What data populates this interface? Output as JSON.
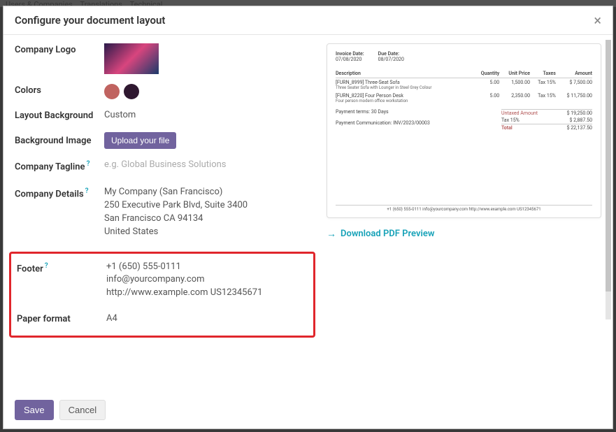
{
  "modal": {
    "title": "Configure your document layout",
    "close_icon": "×"
  },
  "form": {
    "logo_label": "Company Logo",
    "colors_label": "Colors",
    "layout_bg_label": "Layout Background",
    "layout_bg_value": "Custom",
    "bg_image_label": "Background Image",
    "upload_label": "Upload your file",
    "tagline_label": "Company Tagline",
    "tagline_placeholder": "e.g. Global Business Solutions",
    "details_label": "Company Details",
    "details_line1": "My Company (San Francisco)",
    "details_line2": "250 Executive Park Blvd, Suite 3400",
    "details_line3": "San Francisco CA 94134",
    "details_line4": "United States",
    "footer_label": "Footer",
    "footer_line1": "+1 (650) 555-0111",
    "footer_line2": "info@yourcompany.com",
    "footer_line3": "http://www.example.com US12345671",
    "paper_label": "Paper format",
    "paper_value": "A4"
  },
  "preview": {
    "invoice_date_label": "Invoice Date:",
    "invoice_date": "07/08/2020",
    "due_date_label": "Due Date:",
    "due_date": "08/07/2020",
    "th_desc": "Description",
    "th_qty": "Quantity",
    "th_unit": "Unit Price",
    "th_taxes": "Taxes",
    "th_amount": "Amount",
    "r1_name": "[FURN_8999] Three-Seat Sofa",
    "r1_desc": "Three Seater Sofa with Lounger in Steel Grey Colour",
    "r1_qty": "5.00",
    "r1_unit": "1,500.00",
    "r1_tax": "Tax 15%",
    "r1_amount": "$ 7,500.00",
    "r2_name": "[FURN_8220] Four Person Desk",
    "r2_desc": "Four person modern office workstation",
    "r2_qty": "5.00",
    "r2_unit": "2,350.00",
    "r2_tax": "Tax 15%",
    "r2_amount": "$ 11,750.00",
    "terms_label": "Payment terms:",
    "terms_val": "30 Days",
    "comm_label": "Payment Communication:",
    "comm_val": "INV/2023/00003",
    "untaxed_label": "Untaxed Amount",
    "untaxed_val": "$ 19,250.00",
    "tax_label": "Tax 15%",
    "tax_val": "$ 2,887.50",
    "total_label": "Total",
    "total_val": "$ 22,137.50",
    "footer": "+1 (650) 555-0111 info@yourcompany.com http://www.example.com US12345671"
  },
  "download_label": "Download PDF Preview",
  "actions": {
    "save": "Save",
    "cancel": "Cancel"
  },
  "colors": {
    "swatch1": "#c06360",
    "swatch2": "#2f1830"
  }
}
